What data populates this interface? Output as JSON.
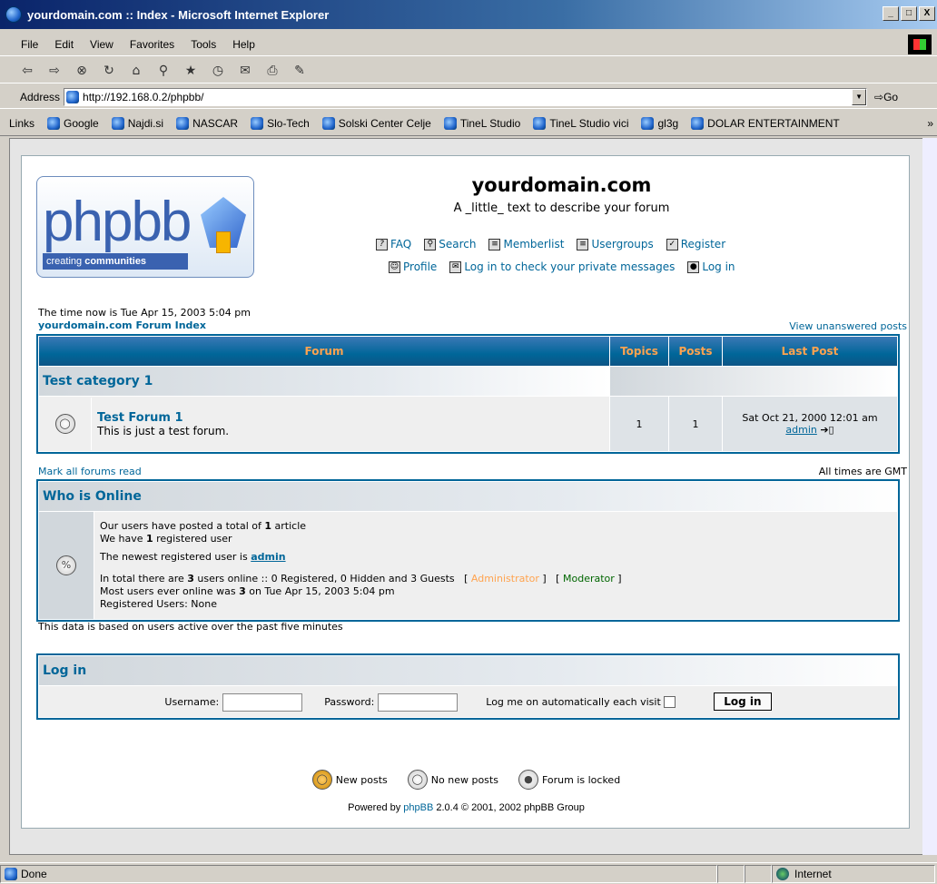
{
  "window": {
    "title": "yourdomain.com :: Index - Microsoft Internet Explorer",
    "min": "_",
    "max": "□",
    "close": "X"
  },
  "menu": [
    "File",
    "Edit",
    "View",
    "Favorites",
    "Tools",
    "Help"
  ],
  "address": {
    "label": "Address",
    "url": "http://192.168.0.2/phpbb/",
    "go": "Go"
  },
  "links": {
    "label": "Links",
    "items": [
      "Google",
      "Najdi.si",
      "NASCAR",
      "Slo-Tech",
      "Solski Center Celje",
      "TineL Studio",
      "TineL Studio vici",
      "gl3g",
      "DOLAR ENTERTAINMENT"
    ],
    "more": "»"
  },
  "site": {
    "title": "yourdomain.com",
    "description": "A _little_ text to describe your forum"
  },
  "nav": {
    "faq": "FAQ",
    "search": "Search",
    "memberlist": "Memberlist",
    "usergroups": "Usergroups",
    "register": "Register",
    "profile": "Profile",
    "pm": "Log in to check your private messages",
    "login": "Log in"
  },
  "time_now": "The time now is Tue Apr 15, 2003 5:04 pm",
  "index_link": "yourdomain.com Forum Index",
  "unanswered": "View unanswered posts",
  "forum_table": {
    "headers": [
      "Forum",
      "Topics",
      "Posts",
      "Last Post"
    ],
    "category": "Test category 1",
    "forum": {
      "name": "Test Forum 1",
      "desc": "This is just a test forum.",
      "topics": "1",
      "posts": "1",
      "last_post_date": "Sat Oct 21, 2000 12:01 am",
      "last_post_user": "admin"
    }
  },
  "mark_read": "Mark all forums read",
  "timezone": "All times are GMT",
  "who_online": {
    "title": "Who is Online",
    "l1a": "Our users have posted a total of ",
    "l1b": "1",
    "l1c": " article",
    "l2a": "We have ",
    "l2b": "1",
    "l2c": " registered user",
    "l3a": "The newest registered user is ",
    "l3b": "admin",
    "l4a": "In total there are ",
    "l4b": "3",
    "l4c": " users online :: 0 Registered, 0 Hidden and 3 Guests   [ ",
    "l4admin": "Administrator",
    "l4d": " ]   [ ",
    "l4mod": "Moderator",
    "l4e": " ]",
    "l5a": "Most users ever online was ",
    "l5b": "3",
    "l5c": " on Tue Apr 15, 2003 5:04 pm",
    "l6": "Registered Users: None",
    "admin_color": "#ffa34f",
    "mod_color": "#006600"
  },
  "based_on": "This data is based on users active over the past five minutes",
  "login": {
    "title": "Log in",
    "username": "Username:",
    "password": "Password:",
    "auto": "Log me on automatically each visit",
    "button": "Log in"
  },
  "legend": {
    "new": "New posts",
    "none": "No new posts",
    "locked": "Forum is locked"
  },
  "powered": {
    "a": "Powered by ",
    "link": "phpBB",
    "b": " 2.0.4 © 2001, 2002 phpBB Group"
  },
  "logo": {
    "text": "phpbb",
    "tagline_a": "creating",
    "tagline_b": "communities"
  },
  "status": {
    "text": "Done",
    "zone": "Internet"
  },
  "colors": {
    "link": "#006699",
    "header_text": "#ffa34f"
  }
}
